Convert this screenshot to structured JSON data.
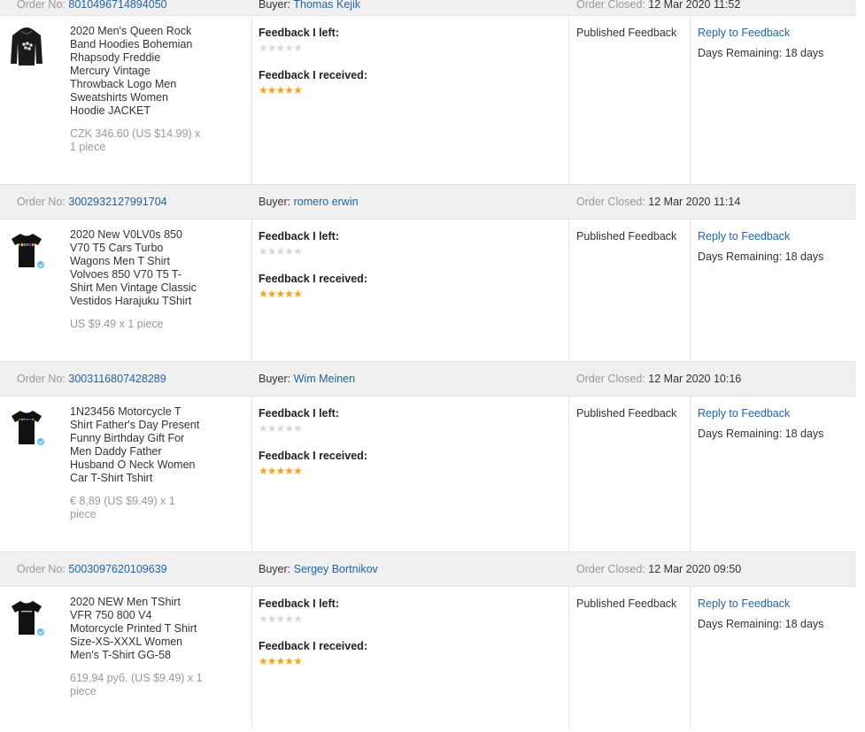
{
  "labels": {
    "order_no": "Order No:",
    "buyer": "Buyer:",
    "order_closed": "Order Closed:",
    "feedback_left": "Feedback I left:",
    "feedback_received": "Feedback I received:",
    "published": "Published Feedback",
    "reply": "Reply to Feedback",
    "days_remaining": "Days Remaining: 18 days"
  },
  "orders": [
    {
      "order_no": "8010496714894050",
      "buyer": "Thomas Kejik",
      "closed": "12 Mar 2020 11:52",
      "title": "2020 Men's Queen Rock Band Hoodies Bohemian Rhapsody Freddie Mercury Vintage Throwback Logo Men Sweatshirts Women Hoodie JACKET",
      "price": "CZK 346.60 (US $14.99) x 1 piece",
      "feedback_left_stars": 0,
      "feedback_received_stars": 5,
      "product_icon": "hoodie-icon"
    },
    {
      "order_no": "3002932127991704",
      "buyer": "romero erwin",
      "closed": "12 Mar 2020 11:14",
      "title": "2020 New V0LV0s 850 V70 T5 Cars Turbo Wagons Men T Shirt Volvoes 850 V70 T5 T-Shirt Men Vintage Classic Vestidos Harajuku TShirt",
      "price": "US $9.49 x 1 piece",
      "feedback_left_stars": 0,
      "feedback_received_stars": 5,
      "product_icon": "tshirt-icon"
    },
    {
      "order_no": "3003116807428289",
      "buyer": "Wim Meinen",
      "closed": "12 Mar 2020 10:16",
      "title": "1N23456 Motorcycle T Shirt Father's Day Present Funny Birthday Gift For Men Daddy Father Husband O Neck Women Car T-Shirt Tshirt",
      "price": "€ 8,89 (US $9.49) x 1 piece",
      "feedback_left_stars": 0,
      "feedback_received_stars": 5,
      "product_icon": "tshirt-icon"
    },
    {
      "order_no": "5003097620109639",
      "buyer": "Sergey Bortnikov",
      "closed": "12 Mar 2020 09:50",
      "title": "2020 NEW Men TShirt VFR 750 800 V4 Motorcycle Printed T Shirt Size-XS-XXXL Women Men's T-Shirt GG-58",
      "price": "619,94 руб. (US $9.49) x 1 piece",
      "feedback_left_stars": 0,
      "feedback_received_stars": 5,
      "product_icon": "tshirt-icon"
    }
  ],
  "colors": {
    "link": "#1f64a8",
    "header_bg": "#f0f0f0",
    "star_filled": "#f5a417",
    "star_empty": "#d8d8d8"
  }
}
